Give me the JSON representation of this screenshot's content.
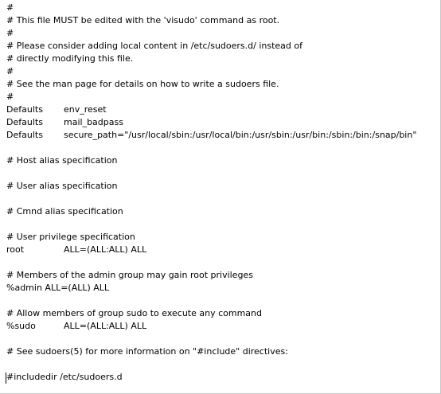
{
  "file": {
    "lines": {
      "l01": "#",
      "l02": "# This file MUST be edited with the 'visudo' command as root.",
      "l03": "#",
      "l04": "# Please consider adding local content in /etc/sudoers.d/ instead of",
      "l05": "# directly modifying this file.",
      "l06": "#",
      "l07": "# See the man page for details on how to write a sudoers file.",
      "l08": "#",
      "l09_key": "Defaults",
      "l09_val": "env_reset",
      "l10_key": "Defaults",
      "l10_val": "mail_badpass",
      "l11_key": "Defaults",
      "l11_val": "secure_path=\"/usr/local/sbin:/usr/local/bin:/usr/sbin:/usr/bin:/sbin:/bin:/snap/bin\"",
      "l13": "# Host alias specification",
      "l15": "# User alias specification",
      "l17": "# Cmnd alias specification",
      "l19": "# User privilege specification",
      "l20_key": "root",
      "l20_val": "ALL=(ALL:ALL) ALL",
      "l22": "# Members of the admin group may gain root privileges",
      "l23": "%admin ALL=(ALL) ALL",
      "l25": "# Allow members of group sudo to execute any command",
      "l26_key": "%sudo",
      "l26_val": "ALL=(ALL:ALL) ALL",
      "l28": "# See sudoers(5) for more information on \"#include\" directives:",
      "l30": "#includedir /etc/sudoers.d"
    }
  }
}
